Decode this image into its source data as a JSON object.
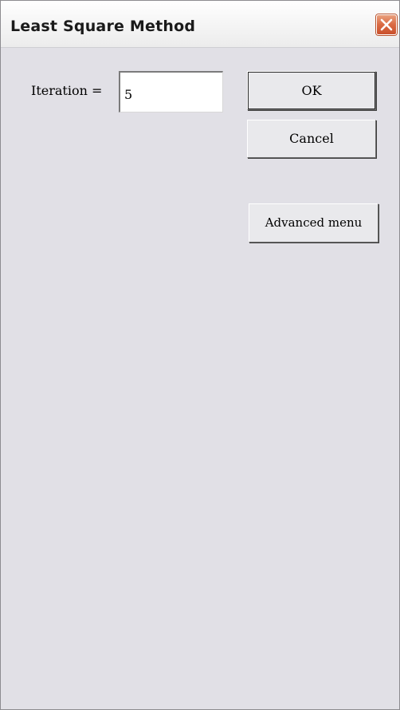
{
  "window": {
    "title": "Least Square Method",
    "close_icon": "close-icon"
  },
  "form": {
    "iteration_label": "Iteration =",
    "iteration_value": "5"
  },
  "buttons": {
    "ok_label": "OK",
    "cancel_label": "Cancel",
    "advanced_label": "Advanced menu"
  },
  "colors": {
    "window_background": "#e1e0e6",
    "close_button": "#da6a43"
  }
}
